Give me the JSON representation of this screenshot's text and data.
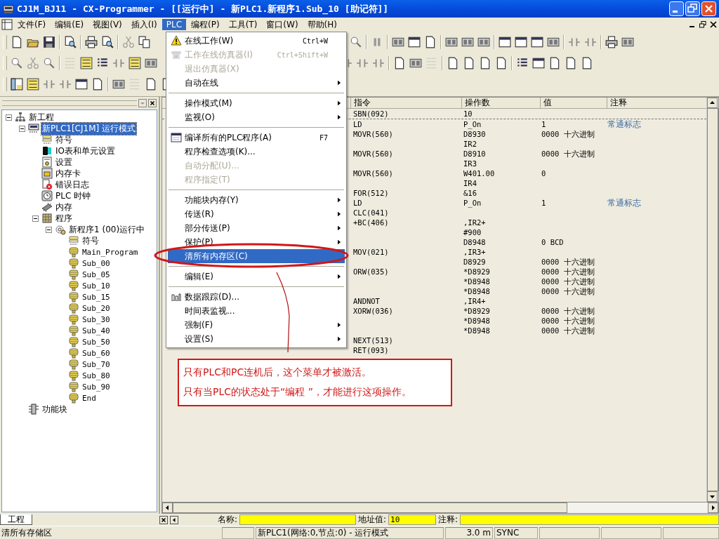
{
  "window": {
    "title": "CJ1M_BJ11 - CX-Programmer - [[运行中] - 新PLC1.新程序1.Sub_10 [助记符]]"
  },
  "menubar": [
    {
      "label": "文件(F)",
      "selected": false
    },
    {
      "label": "编辑(E)",
      "selected": false
    },
    {
      "label": "视图(V)",
      "selected": false
    },
    {
      "label": "插入(I)",
      "selected": false
    },
    {
      "label": "PLC",
      "selected": true
    },
    {
      "label": "编程(P)",
      "selected": false
    },
    {
      "label": "工具(T)",
      "selected": false
    },
    {
      "label": "窗口(W)",
      "selected": false
    },
    {
      "label": "帮助(H)",
      "selected": false
    }
  ],
  "plc_menu": [
    {
      "kind": "item",
      "label": "在线工作(W)",
      "shortcut": "Ctrl+W",
      "disabled": false,
      "submenu": false,
      "selected": false
    },
    {
      "kind": "item",
      "label": "工作在线仿真器(I)",
      "shortcut": "Ctrl+Shift+W",
      "disabled": true,
      "submenu": false,
      "selected": false
    },
    {
      "kind": "item",
      "label": "退出仿真器(X)",
      "disabled": true,
      "submenu": false,
      "selected": false
    },
    {
      "kind": "item",
      "label": "自动在线",
      "disabled": false,
      "submenu": true,
      "selected": false
    },
    {
      "kind": "separator"
    },
    {
      "kind": "item",
      "label": "操作模式(M)",
      "disabled": false,
      "submenu": true,
      "selected": false
    },
    {
      "kind": "item",
      "label": "监视(O)",
      "disabled": false,
      "submenu": true,
      "selected": false
    },
    {
      "kind": "separator"
    },
    {
      "kind": "item",
      "label": "编译所有的PLC程序(A)",
      "shortcut": "F7",
      "disabled": false,
      "submenu": false,
      "selected": false
    },
    {
      "kind": "item",
      "label": "程序检查选项(K)...",
      "disabled": false,
      "submenu": false,
      "selected": false
    },
    {
      "kind": "item",
      "label": "自动分配(U)...",
      "disabled": true,
      "submenu": false,
      "selected": false
    },
    {
      "kind": "item",
      "label": "程序指定(T)",
      "disabled": true,
      "submenu": false,
      "selected": false
    },
    {
      "kind": "separator"
    },
    {
      "kind": "item",
      "label": "功能块内存(Y)",
      "disabled": false,
      "submenu": true,
      "selected": false
    },
    {
      "kind": "item",
      "label": "传送(R)",
      "disabled": false,
      "submenu": true,
      "selected": false
    },
    {
      "kind": "item",
      "label": "部分传送(P)",
      "disabled": false,
      "submenu": true,
      "selected": false
    },
    {
      "kind": "item",
      "label": "保护(P)",
      "disabled": false,
      "submenu": true,
      "selected": false
    },
    {
      "kind": "item",
      "label": "清所有内存区(C)",
      "disabled": false,
      "submenu": false,
      "selected": true
    },
    {
      "kind": "separator"
    },
    {
      "kind": "item",
      "label": "编辑(E)",
      "disabled": false,
      "submenu": true,
      "selected": false
    },
    {
      "kind": "separator"
    },
    {
      "kind": "item",
      "label": "数据跟踪(D)...",
      "disabled": false,
      "submenu": false,
      "selected": false
    },
    {
      "kind": "item",
      "label": "时间表监视...",
      "disabled": false,
      "submenu": false,
      "selected": false
    },
    {
      "kind": "item",
      "label": "强制(F)",
      "disabled": false,
      "submenu": true,
      "selected": false
    },
    {
      "kind": "item",
      "label": "设置(S)",
      "disabled": false,
      "submenu": true,
      "selected": false
    }
  ],
  "project_tree": {
    "nodes": [
      {
        "label": "新工程",
        "kind": "network",
        "expanded": true,
        "selected": false,
        "children": [
          {
            "label": "新PLC1[CJ1M] 运行模式",
            "kind": "plc",
            "expanded": true,
            "selected": true,
            "children": [
              {
                "label": "符号",
                "kind": "symbols",
                "selected": false
              },
              {
                "label": "IO表和单元设置",
                "kind": "io",
                "selected": false
              },
              {
                "label": "设置",
                "kind": "settings",
                "selected": false
              },
              {
                "label": "内存卡",
                "kind": "card",
                "selected": false
              },
              {
                "label": "错误日志",
                "kind": "errorlog",
                "selected": false
              },
              {
                "label": "PLC 时钟",
                "kind": "clock",
                "selected": false
              },
              {
                "label": "内存",
                "kind": "chip",
                "selected": false
              },
              {
                "label": "程序",
                "kind": "programs",
                "expanded": true,
                "selected": false,
                "children": [
                  {
                    "label": "新程序1 (00)运行中",
                    "kind": "program",
                    "expanded": true,
                    "selected": false,
                    "children": [
                      {
                        "label": "符号",
                        "kind": "symbols",
                        "selected": false
                      },
                      {
                        "label": "Main_Program",
                        "kind": "section",
                        "selected": false
                      },
                      {
                        "label": "Sub_00",
                        "kind": "section",
                        "selected": false
                      },
                      {
                        "label": "Sub_05",
                        "kind": "section",
                        "selected": false
                      },
                      {
                        "label": "Sub_10",
                        "kind": "section",
                        "selected": false
                      },
                      {
                        "label": "Sub_15",
                        "kind": "section",
                        "selected": false
                      },
                      {
                        "label": "Sub_20",
                        "kind": "section",
                        "selected": false
                      },
                      {
                        "label": "Sub_30",
                        "kind": "section",
                        "selected": false
                      },
                      {
                        "label": "Sub_40",
                        "kind": "section",
                        "selected": false
                      },
                      {
                        "label": "Sub_50",
                        "kind": "section",
                        "selected": false
                      },
                      {
                        "label": "Sub_60",
                        "kind": "section",
                        "selected": false
                      },
                      {
                        "label": "Sub_70",
                        "kind": "section",
                        "selected": false
                      },
                      {
                        "label": "Sub_80",
                        "kind": "section",
                        "selected": false
                      },
                      {
                        "label": "Sub_90",
                        "kind": "section",
                        "selected": false
                      },
                      {
                        "label": "End",
                        "kind": "section",
                        "selected": false
                      }
                    ]
                  }
                ]
              }
            ]
          },
          {
            "label": "功能块",
            "kind": "fb",
            "selected": false
          }
        ]
      }
    ],
    "tab": "工程"
  },
  "mnemonic_table": {
    "columns": [
      "指令",
      "操作数",
      "值",
      "注释"
    ],
    "rows": [
      {
        "instruction": "SBN(092)",
        "operand": "10"
      },
      {
        "instruction": "LD",
        "operand": "P_On",
        "value": "1",
        "comment": "常通标志"
      },
      {
        "instruction": "MOVR(560)",
        "operand": "D8930",
        "value": "0000 十六进制"
      },
      {
        "operand": "IR2"
      },
      {
        "instruction": "MOVR(560)",
        "operand": "D8910",
        "value": "0000 十六进制"
      },
      {
        "operand": "IR3"
      },
      {
        "instruction": "MOVR(560)",
        "operand": "W401.00",
        "value": "0"
      },
      {
        "operand": "IR4"
      },
      {
        "instruction": "FOR(512)",
        "operand": "&16"
      },
      {
        "instruction": "LD",
        "operand": "P_On",
        "value": "1",
        "comment": "常通标志"
      },
      {
        "instruction": "CLC(041)"
      },
      {
        "instruction": "+BC(406)",
        "operand": ",IR2+"
      },
      {
        "operand": "#900"
      },
      {
        "operand": "D8948",
        "value": "0 BCD"
      },
      {
        "instruction": "MOV(021)",
        "operand": ",IR3+"
      },
      {
        "operand": "D8929",
        "value": "0000 十六进制"
      },
      {
        "instruction": "ORW(035)",
        "operand": "*D8929",
        "value": "0000 十六进制"
      },
      {
        "operand": "*D8948",
        "value": "0000 十六进制"
      },
      {
        "operand": "*D8948",
        "value": "0000 十六进制"
      },
      {
        "instruction": "ANDNOT",
        "operand": ",IR4+"
      },
      {
        "instruction": "XORW(036)",
        "operand": "*D8929",
        "value": "0000 十六进制"
      },
      {
        "operand": "*D8948",
        "value": "0000 十六进制"
      },
      {
        "operand": "*D8948",
        "value": "0000 十六进制"
      },
      {
        "instruction": "NEXT(513)"
      },
      {
        "instruction": "RET(093)"
      }
    ]
  },
  "address_bar": {
    "name_label": "名称:",
    "address_label": "地址值:",
    "address_value": "10",
    "comment_label": "注释:"
  },
  "status_bar": {
    "message": "清所有存储区",
    "connection": "新PLC1(网络:0,节点:0) - 运行模式",
    "time": "3.0 m",
    "sync": "SYNC"
  },
  "annotation": {
    "lines": [
      "只有PLC和PC连机后，这个菜单才被激活。",
      "只有当PLC的状态处于“编程 ”，才能进行这项操作。"
    ]
  }
}
